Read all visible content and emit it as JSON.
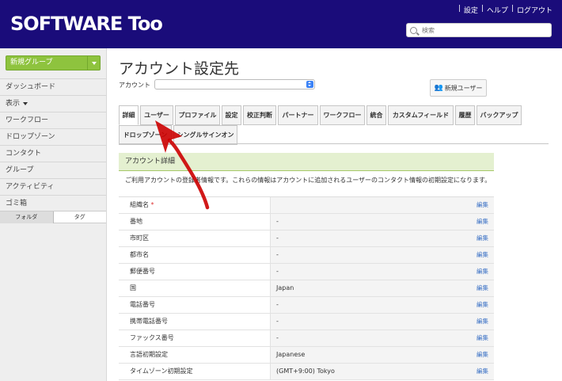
{
  "header": {
    "logo": "SOFTWARE Too",
    "links": [
      "|",
      "設定",
      "|",
      "ヘルプ",
      "|",
      "ログアウト"
    ],
    "search_placeholder": "検索"
  },
  "sidebar": {
    "new_group": "新規グループ",
    "items": [
      "ダッシュボード",
      "表示",
      "ワークフロー",
      "ドロップゾーン",
      "コンタクト",
      "グループ",
      "アクティビティ",
      "ゴミ箱"
    ],
    "tabs": [
      "フォルダ",
      "タグ"
    ]
  },
  "main": {
    "title": "アカウント設定先",
    "account_label": "アカウント",
    "new_user_label": "新規ユーザー",
    "tabs_row1": [
      "詳細",
      "ユーザー",
      "プロファイル",
      "設定",
      "校正判断",
      "パートナー",
      "ワークフロー",
      "統合",
      "カスタムフィールド",
      "履歴",
      "バックアップ"
    ],
    "tabs_row2": [
      "ドロップゾーン",
      "シングルサインオン"
    ],
    "section_title": "アカウント詳細",
    "section_desc": "ご利用アカウントの登録者情報です。これらの情報はアカウントに追加されるユーザーのコンタクト情報の初期設定になります。",
    "edit_label": "編集",
    "rows": [
      {
        "label": "組織名",
        "value": "",
        "required": "*"
      },
      {
        "label": "番地",
        "value": "-"
      },
      {
        "label": "市町区",
        "value": "-"
      },
      {
        "label": "都市名",
        "value": "-"
      },
      {
        "label": "郵便番号",
        "value": "-"
      },
      {
        "label": "国",
        "value": "Japan"
      },
      {
        "label": "電話番号",
        "value": "-"
      },
      {
        "label": "携帯電話番号",
        "value": "-"
      },
      {
        "label": "ファックス番号",
        "value": "-"
      },
      {
        "label": "言語初期設定",
        "value": "Japanese"
      },
      {
        "label": "タイムゾーン初期設定",
        "value": "(GMT+9:00) Tokyo"
      }
    ]
  },
  "colors": {
    "header_bg": "#1a0c7a",
    "new_group_bg": "#8ec33e",
    "section_bg": "#e4f0d0",
    "edit_link": "#3f74c6",
    "annotation_arrow": "#cc0000"
  }
}
